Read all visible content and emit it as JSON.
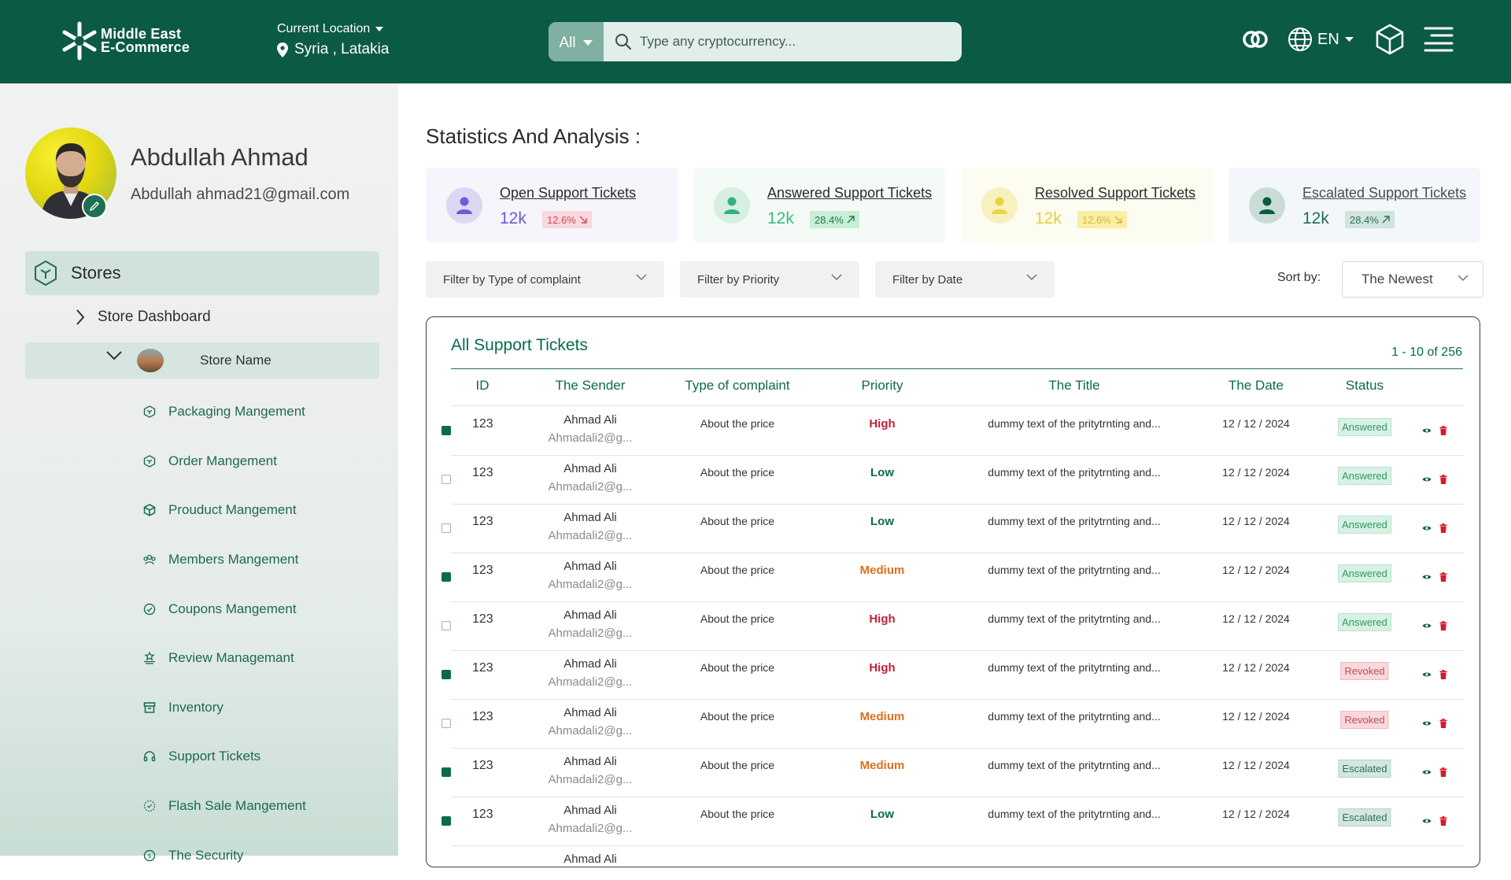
{
  "header": {
    "logo_line1": "Middle East",
    "logo_line2": "E-Commerce",
    "location_label": "Current Location",
    "location_value": "Syria , Latakia",
    "search_category": "All",
    "search_placeholder": "Type any cryptocurrency...",
    "language": "EN"
  },
  "profile": {
    "name": "Abdullah Ahmad",
    "email": "Abdullah ahmad21@gmail.com"
  },
  "sidebar": {
    "stores_label": "Stores",
    "store_dashboard": "Store Dashboard",
    "store_name": "Store Name",
    "menu": [
      {
        "label": "Packaging Mangement",
        "icon": "box-icon"
      },
      {
        "label": "Order Mangement",
        "icon": "box-icon"
      },
      {
        "label": "Prouduct Mangement",
        "icon": "cube-icon"
      },
      {
        "label": "Members Mangement",
        "icon": "users-icon"
      },
      {
        "label": "Coupons Mangement",
        "icon": "coupon-icon"
      },
      {
        "label": "Review Managemant",
        "icon": "review-icon"
      },
      {
        "label": "Inventory",
        "icon": "archive-icon"
      },
      {
        "label": "Support Tickets",
        "icon": "headset-icon"
      },
      {
        "label": "Flash Sale Mangement",
        "icon": "flash-sale-icon"
      },
      {
        "label": "The Security",
        "icon": "security-icon"
      }
    ]
  },
  "main": {
    "title": "Statistics And Analysis :",
    "stats": [
      {
        "title": "Open Support Tickets",
        "value": "12k",
        "change": "12.6%",
        "trend": "down"
      },
      {
        "title": "Answered Support Tickets",
        "value": "12k",
        "change": "28.4%",
        "trend": "up"
      },
      {
        "title": "Resolved Support Tickets",
        "value": "12k",
        "change": "12.6%",
        "trend": "down"
      },
      {
        "title": "Escalated Support Tickets",
        "value": "12k",
        "change": "28.4%",
        "trend": "up"
      }
    ],
    "filters": {
      "type": "Filter by Type of complaint",
      "priority": "Filter by Priority",
      "date": "Filter by Date",
      "sort_label": "Sort by:",
      "sort_value": "The Newest"
    },
    "colors": {
      "primary": "#0b5a45",
      "high": "#c4203a",
      "low": "#0b6a4e",
      "medium": "#e0701a"
    }
  },
  "table": {
    "title": "All Support Tickets",
    "range": "1 - 10 of 256",
    "columns": [
      "ID",
      "The Sender",
      "Type of complaint",
      "Priority",
      "The Title",
      "The Date",
      "Status"
    ],
    "rows": [
      {
        "checked": true,
        "id": "123",
        "sender": "Ahmad Ali",
        "email": "Ahmadali2@g...",
        "type": "About the price",
        "priority": "High",
        "title": "dummy text of the pritytrnting and...",
        "date": "12 / 12 / 2024",
        "status": "Answered"
      },
      {
        "checked": false,
        "id": "123",
        "sender": "Ahmad Ali",
        "email": "Ahmadali2@g...",
        "type": "About the price",
        "priority": "Low",
        "title": "dummy text of the pritytrnting and...",
        "date": "12 / 12 / 2024",
        "status": "Answered"
      },
      {
        "checked": false,
        "id": "123",
        "sender": "Ahmad Ali",
        "email": "Ahmadali2@g...",
        "type": "About the price",
        "priority": "Low",
        "title": "dummy text of the pritytrnting and...",
        "date": "12 / 12 / 2024",
        "status": "Answered"
      },
      {
        "checked": true,
        "id": "123",
        "sender": "Ahmad Ali",
        "email": "Ahmadali2@g...",
        "type": "About the price",
        "priority": "Medium",
        "title": "dummy text of the pritytrnting and...",
        "date": "12 / 12 / 2024",
        "status": "Answered"
      },
      {
        "checked": false,
        "id": "123",
        "sender": "Ahmad Ali",
        "email": "Ahmadali2@g...",
        "type": "About the price",
        "priority": "High",
        "title": "dummy text of the pritytrnting and...",
        "date": "12 / 12 / 2024",
        "status": "Answered"
      },
      {
        "checked": true,
        "id": "123",
        "sender": "Ahmad Ali",
        "email": "Ahmadali2@g...",
        "type": "About the price",
        "priority": "High",
        "title": "dummy text of the pritytrnting and...",
        "date": "12 / 12 / 2024",
        "status": "Revoked"
      },
      {
        "checked": false,
        "id": "123",
        "sender": "Ahmad Ali",
        "email": "Ahmadali2@g...",
        "type": "About the price",
        "priority": "Medium",
        "title": "dummy text of the pritytrnting and...",
        "date": "12 / 12 / 2024",
        "status": "Revoked"
      },
      {
        "checked": true,
        "id": "123",
        "sender": "Ahmad Ali",
        "email": "Ahmadali2@g...",
        "type": "About the price",
        "priority": "Medium",
        "title": "dummy text of the pritytrnting and...",
        "date": "12 / 12 / 2024",
        "status": "Escalated"
      },
      {
        "checked": true,
        "id": "123",
        "sender": "Ahmad Ali",
        "email": "Ahmadali2@g...",
        "type": "About the price",
        "priority": "Low",
        "title": "dummy text of the pritytrnting and...",
        "date": "12 / 12 / 2024",
        "status": "Escalated"
      },
      {
        "checked": false,
        "id": "",
        "sender": "Ahmad Ali",
        "email": "",
        "type": "",
        "priority": "",
        "title": "",
        "date": "",
        "status": ""
      }
    ]
  }
}
